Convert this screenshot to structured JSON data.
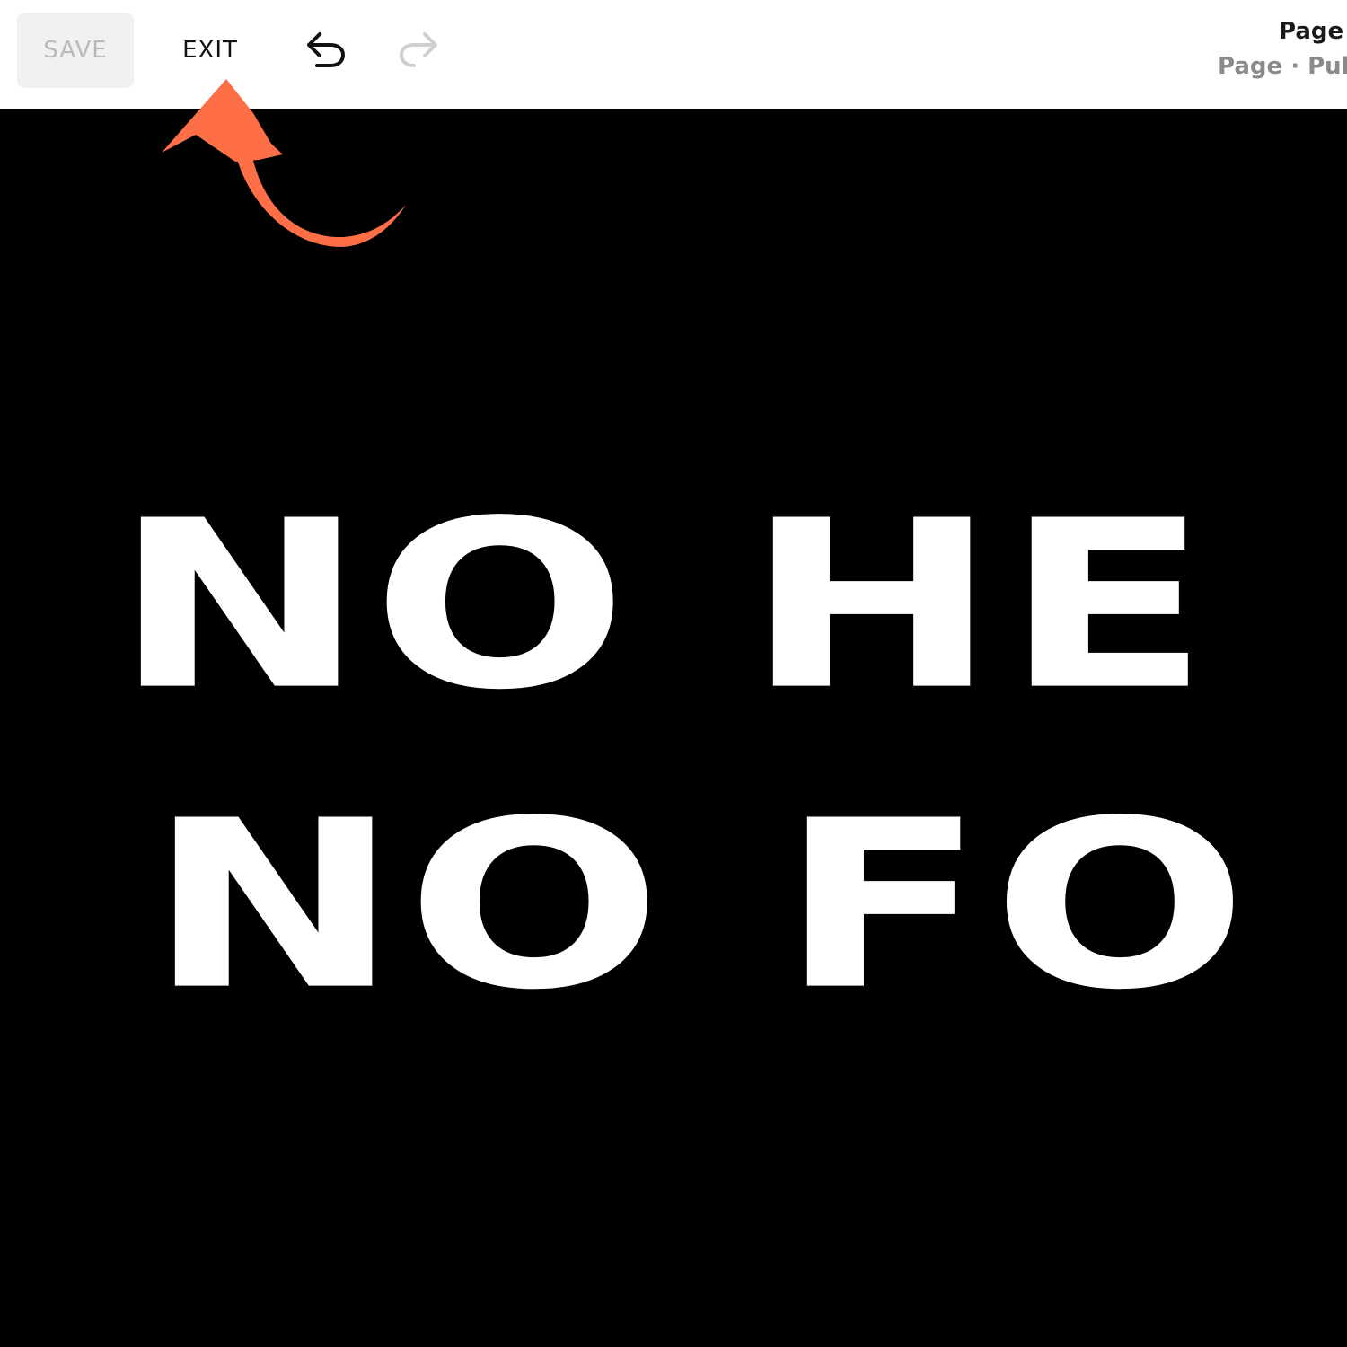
{
  "toolbar": {
    "save_label": "SAVE",
    "exit_label": "EXIT",
    "undo_icon": "undo-arrow-icon",
    "redo_icon": "redo-arrow-icon"
  },
  "page_info": {
    "title": "Page",
    "subtitle": "Page · Pub"
  },
  "hero": {
    "line1": "NO HE",
    "line2": "NO FO"
  },
  "colors": {
    "toolbar_bg": "#ffffff",
    "canvas_bg": "#000000",
    "hero_text": "#ffffff",
    "save_bg": "#f1f1f1",
    "save_text": "#b9b9b9",
    "annotation": "#ff6f47",
    "redo_disabled": "#cfcfcf"
  },
  "annotation": {
    "icon": "curved-arrow-icon"
  }
}
